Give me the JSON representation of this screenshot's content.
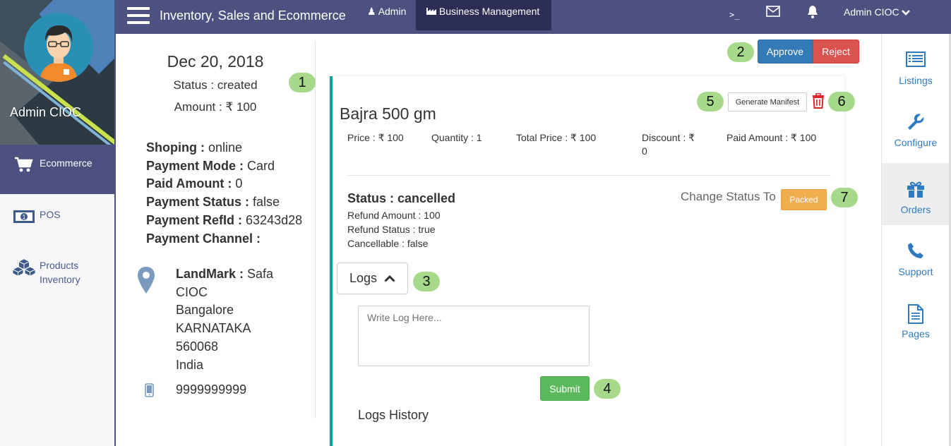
{
  "topbar": {
    "title": "Inventory, Sales and Ecommerce",
    "admin_label": "Admin",
    "business_label": "Business Management",
    "terminal_glyph": ">_",
    "user_label": "Admin CIOC"
  },
  "sidebar": {
    "profile_name": "Admin CIOC",
    "items": [
      {
        "label": "Ecommerce",
        "icon": "cart-icon",
        "active": true
      },
      {
        "label": "POS",
        "icon": "cash-icon",
        "active": false
      },
      {
        "label": "Products\nInventory",
        "icon": "cubes-icon",
        "active": false
      }
    ]
  },
  "order": {
    "date": "Dec 20, 2018",
    "status": "Status : created",
    "amount": "Amount : ₹ 100",
    "details": [
      {
        "key": "Shoping :",
        "value": " online"
      },
      {
        "key": "Payment Mode :",
        "value": " Card"
      },
      {
        "key": "Paid Amount :",
        "value": " 0"
      },
      {
        "key": "Payment Status :",
        "value": " false"
      },
      {
        "key": "Payment RefId :",
        "value": " 63243d28"
      },
      {
        "key": "Payment Channel :",
        "value": ""
      }
    ],
    "address": {
      "landmark_key": "LandMark :",
      "landmark_value": " Safa",
      "line1": "CIOC",
      "city": "Bangalore",
      "state": "KARNATAKA",
      "pincode": "560068",
      "country": "India"
    },
    "phone": "9999999999"
  },
  "actions": {
    "approve": "Approve",
    "reject": "Reject"
  },
  "product": {
    "title": "Bajra 500 gm",
    "generate_manifest": "Generate Manifest",
    "price": "Price : ₹ 100",
    "quantity": "Quantity : 1",
    "total_price": "Total Price : ₹ 100",
    "discount_line1": "Discount : ₹",
    "discount_line2": "0",
    "paid_amount": "Paid Amount : ₹ 100",
    "status": "Status : cancelled",
    "refund_amount": "Refund Amount : 100",
    "refund_status": "Refund Status : true",
    "cancellable": "Cancellable : false",
    "change_status_label": "Change Status To",
    "change_status_button": "Packed"
  },
  "logs": {
    "toggle_label": "Logs",
    "placeholder": "Write Log Here...",
    "submit": "Submit",
    "history_label": "Logs History"
  },
  "annotations": [
    "1",
    "2",
    "3",
    "4",
    "5",
    "6",
    "7"
  ],
  "right_sidebar": [
    {
      "label": "Listings",
      "icon": "listings-icon"
    },
    {
      "label": "Configure",
      "icon": "wrench-icon"
    },
    {
      "label": "Orders",
      "icon": "gift-icon",
      "active": true
    },
    {
      "label": "Support",
      "icon": "phone-icon"
    },
    {
      "label": "Pages",
      "icon": "document-icon"
    }
  ],
  "colors": {
    "primary": "#4d5180",
    "accent": "#16a09a",
    "approve": "#337ab7",
    "reject": "#d9534f",
    "submit": "#5cb85c",
    "packed": "#f0ad4e",
    "annotation": "#a6d98a"
  }
}
